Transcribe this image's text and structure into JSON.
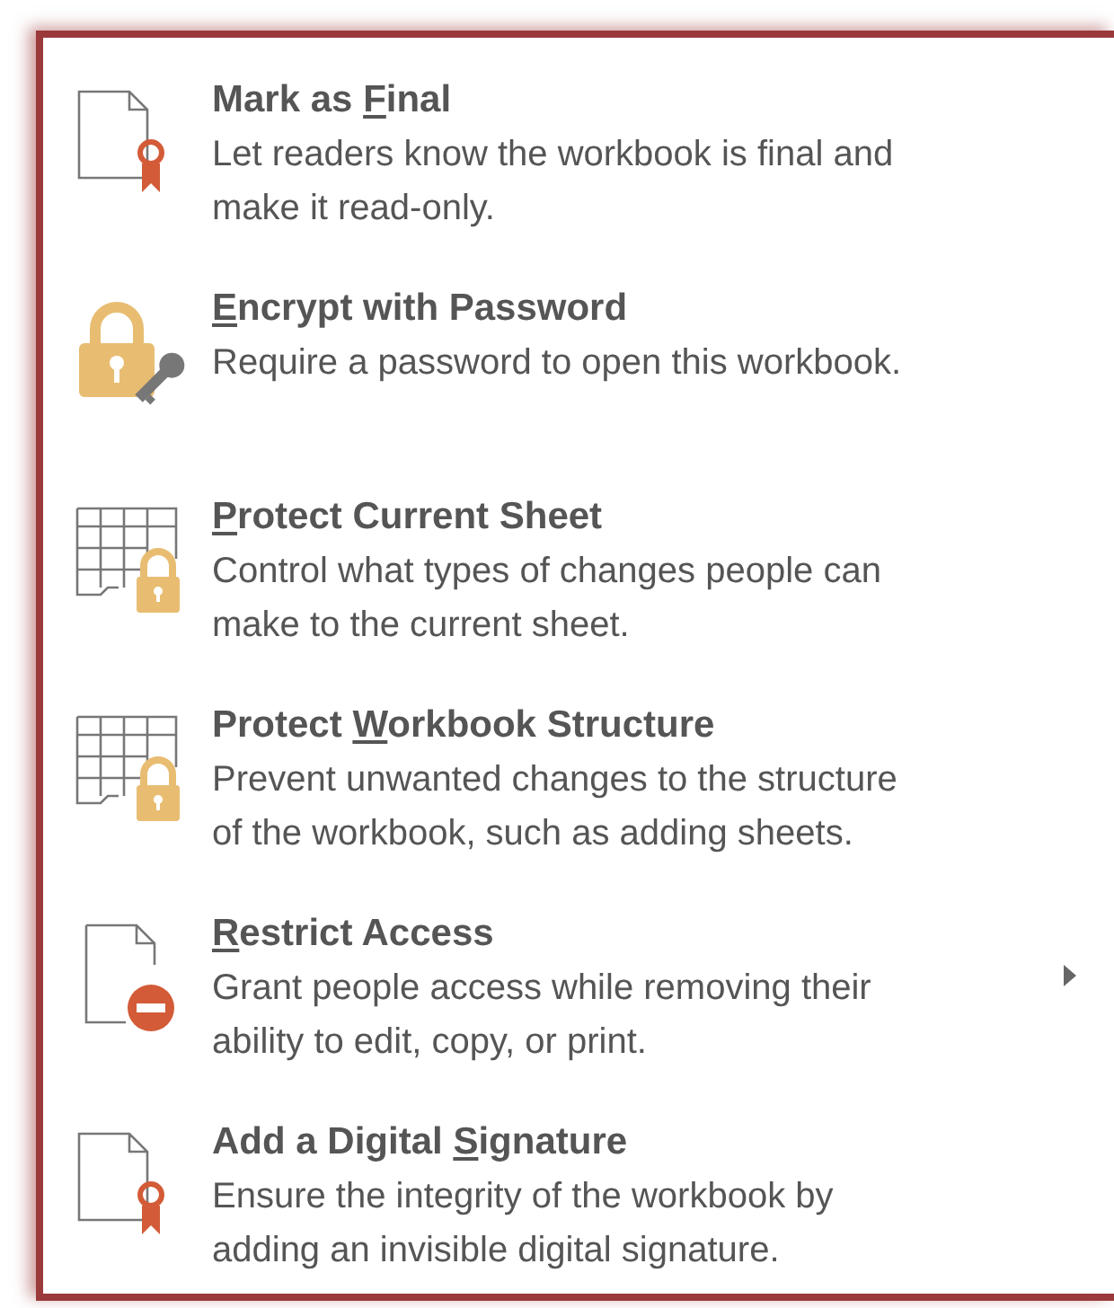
{
  "menu_items": [
    {
      "kind": "ribbon",
      "title": {
        "before": "Mark as ",
        "key": "F",
        "after": "inal"
      },
      "description": "Let readers know the workbook is final and\nmake it read-only.",
      "submenu": false
    },
    {
      "kind": "lock",
      "title": {
        "key": "E",
        "after": "ncrypt with Password"
      },
      "description": "Require a password to open this workbook.",
      "submenu": false
    },
    {
      "kind": "sheet",
      "title": {
        "key": "P",
        "after": "rotect Current Sheet"
      },
      "description": "Control what types of changes people can\nmake to the current sheet.",
      "submenu": false
    },
    {
      "kind": "sheet",
      "title": {
        "before": "Protect ",
        "key": "W",
        "after": "orkbook Structure"
      },
      "description": "Prevent unwanted changes to the structure\nof the workbook, such as adding sheets.",
      "submenu": false
    },
    {
      "kind": "block",
      "title": {
        "key": "R",
        "after": "estrict Access"
      },
      "description": "Grant people access while removing their\nability to edit, copy, or print.",
      "submenu": true
    },
    {
      "kind": "ribbon",
      "title": {
        "before": "Add a Digital ",
        "key": "S",
        "after": "ignature"
      },
      "description": "Ensure the integrity of the workbook by\nadding an invisible digital signature.",
      "submenu": false
    }
  ]
}
